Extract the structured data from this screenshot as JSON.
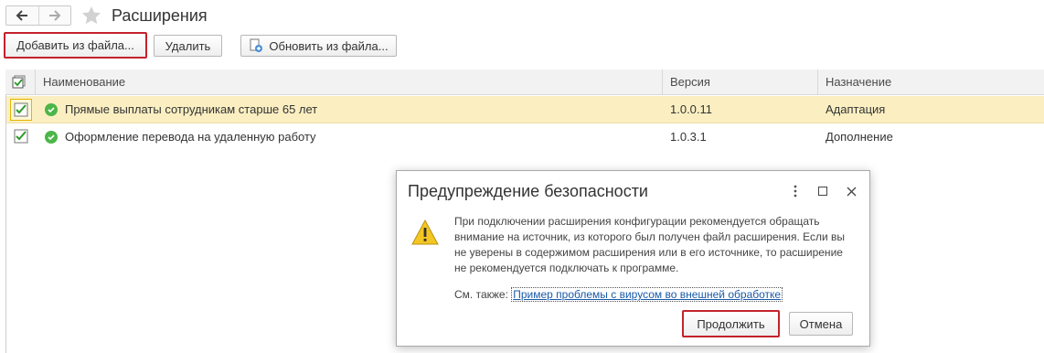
{
  "header": {
    "title": "Расширения"
  },
  "toolbar": {
    "add_label": "Добавить из файла...",
    "delete_label": "Удалить",
    "update_label": "Обновить из файла..."
  },
  "table": {
    "columns": [
      "Наименование",
      "Версия",
      "Назначение"
    ],
    "rows": [
      {
        "name": "Прямые выплаты сотрудникам старше 65 лет",
        "version": "1.0.0.11",
        "purpose": "Адаптация"
      },
      {
        "name": "Оформление перевода на удаленную работу",
        "version": "1.0.3.1",
        "purpose": "Дополнение"
      }
    ]
  },
  "dialog": {
    "title": "Предупреждение безопасности",
    "message": "При подключении расширения конфигурации рекомендуется обращать внимание на источник, из которого был получен файл расширения. Если вы не уверены в содержимом расширения или в его источнике, то расширение не рекомендуется подключать к программе.",
    "see_also_label": "См. также:",
    "link_text": "Пример проблемы с вирусом во внешней обработке",
    "continue_label": "Продолжить",
    "cancel_label": "Отмена"
  },
  "colors": {
    "highlight_red": "#c3232c",
    "selected_row": "#fbefc2",
    "status_ok": "#4cb648",
    "warning": "#f3c623",
    "link": "#1a5aa8"
  }
}
